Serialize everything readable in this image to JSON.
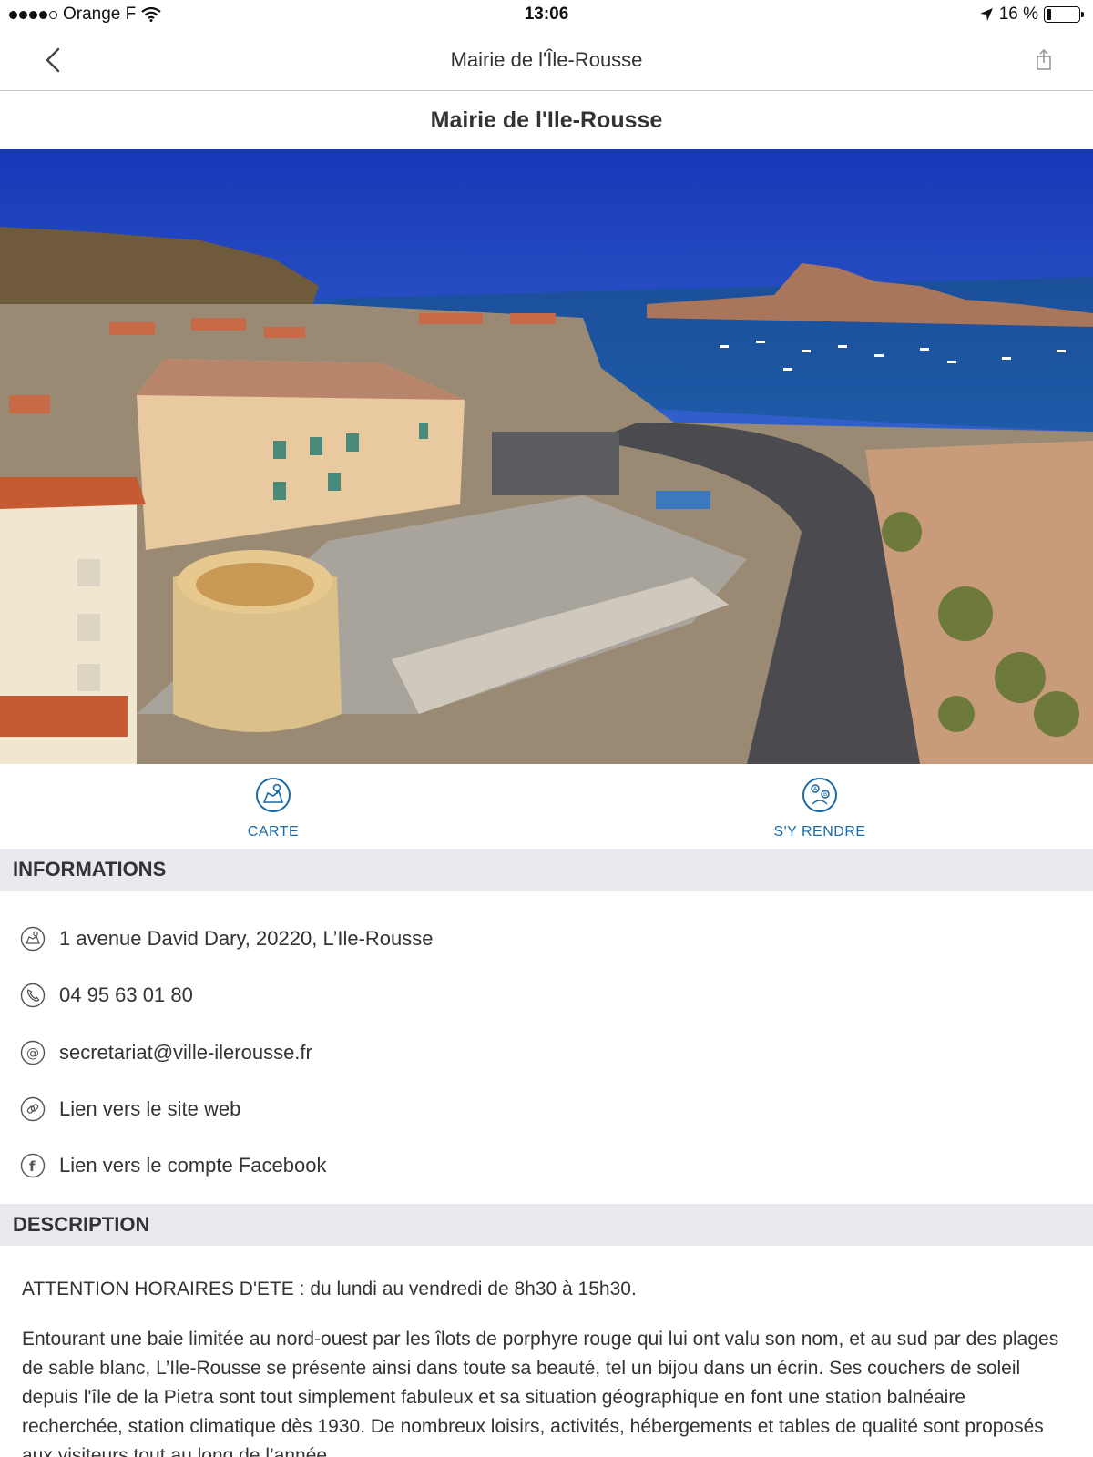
{
  "status_bar": {
    "carrier": "Orange F",
    "time": "13:06",
    "battery": "16 %"
  },
  "nav": {
    "title": "Mairie de l'Île-Rousse"
  },
  "page_title": "Mairie de l'Ile-Rousse",
  "actions": {
    "map_label": "CARTE",
    "directions_label": "S'Y RENDRE"
  },
  "informations": {
    "header": "INFORMATIONS",
    "address": "1 avenue David Dary, 20220, L’Ile-Rousse",
    "phone": "04 95 63 01 80",
    "email": "secretariat@ville-ilerousse.fr",
    "website": "Lien vers le site web",
    "facebook": "Lien vers le compte Facebook"
  },
  "description": {
    "header": "DESCRIPTION",
    "hours": "ATTENTION HORAIRES D'ETE : du lundi au vendredi de 8h30 à 15h30.",
    "body": "Entourant une baie limitée au nord-ouest par les îlots de porphyre rouge qui lui ont valu son nom, et au sud par des plages de sable blanc, L’Ile-Rousse se présente ainsi dans toute sa beauté, tel un bijou dans un écrin. Ses couchers de soleil depuis l'île de la Pietra sont tout simplement fabuleux et sa situation géographique en font une station balnéaire recherchée, station climatique dès 1930. De nombreux loisirs, activités, hébergements et tables de qualité sont proposés aux visiteurs tout au long de l’année."
  },
  "colors": {
    "accent": "#1a6aa6",
    "section_bg": "#e9e9ef"
  }
}
